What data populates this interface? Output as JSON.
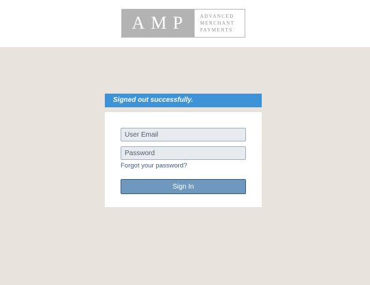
{
  "logo": {
    "mark": "AMP",
    "line1": "ADVANCED",
    "line2": "MERCHANT",
    "line3": "PAYMENTS"
  },
  "flash": {
    "message": "Signed out successfully."
  },
  "login": {
    "email_placeholder": "User Email",
    "password_placeholder": "Password",
    "forgot_label": "Forgot your password?",
    "submit_label": "Sign In"
  },
  "colors": {
    "page_background": "#e8e3dd",
    "flash_background": "#3d92d8",
    "button_background": "#6e98bd",
    "link": "#3a5d82"
  }
}
